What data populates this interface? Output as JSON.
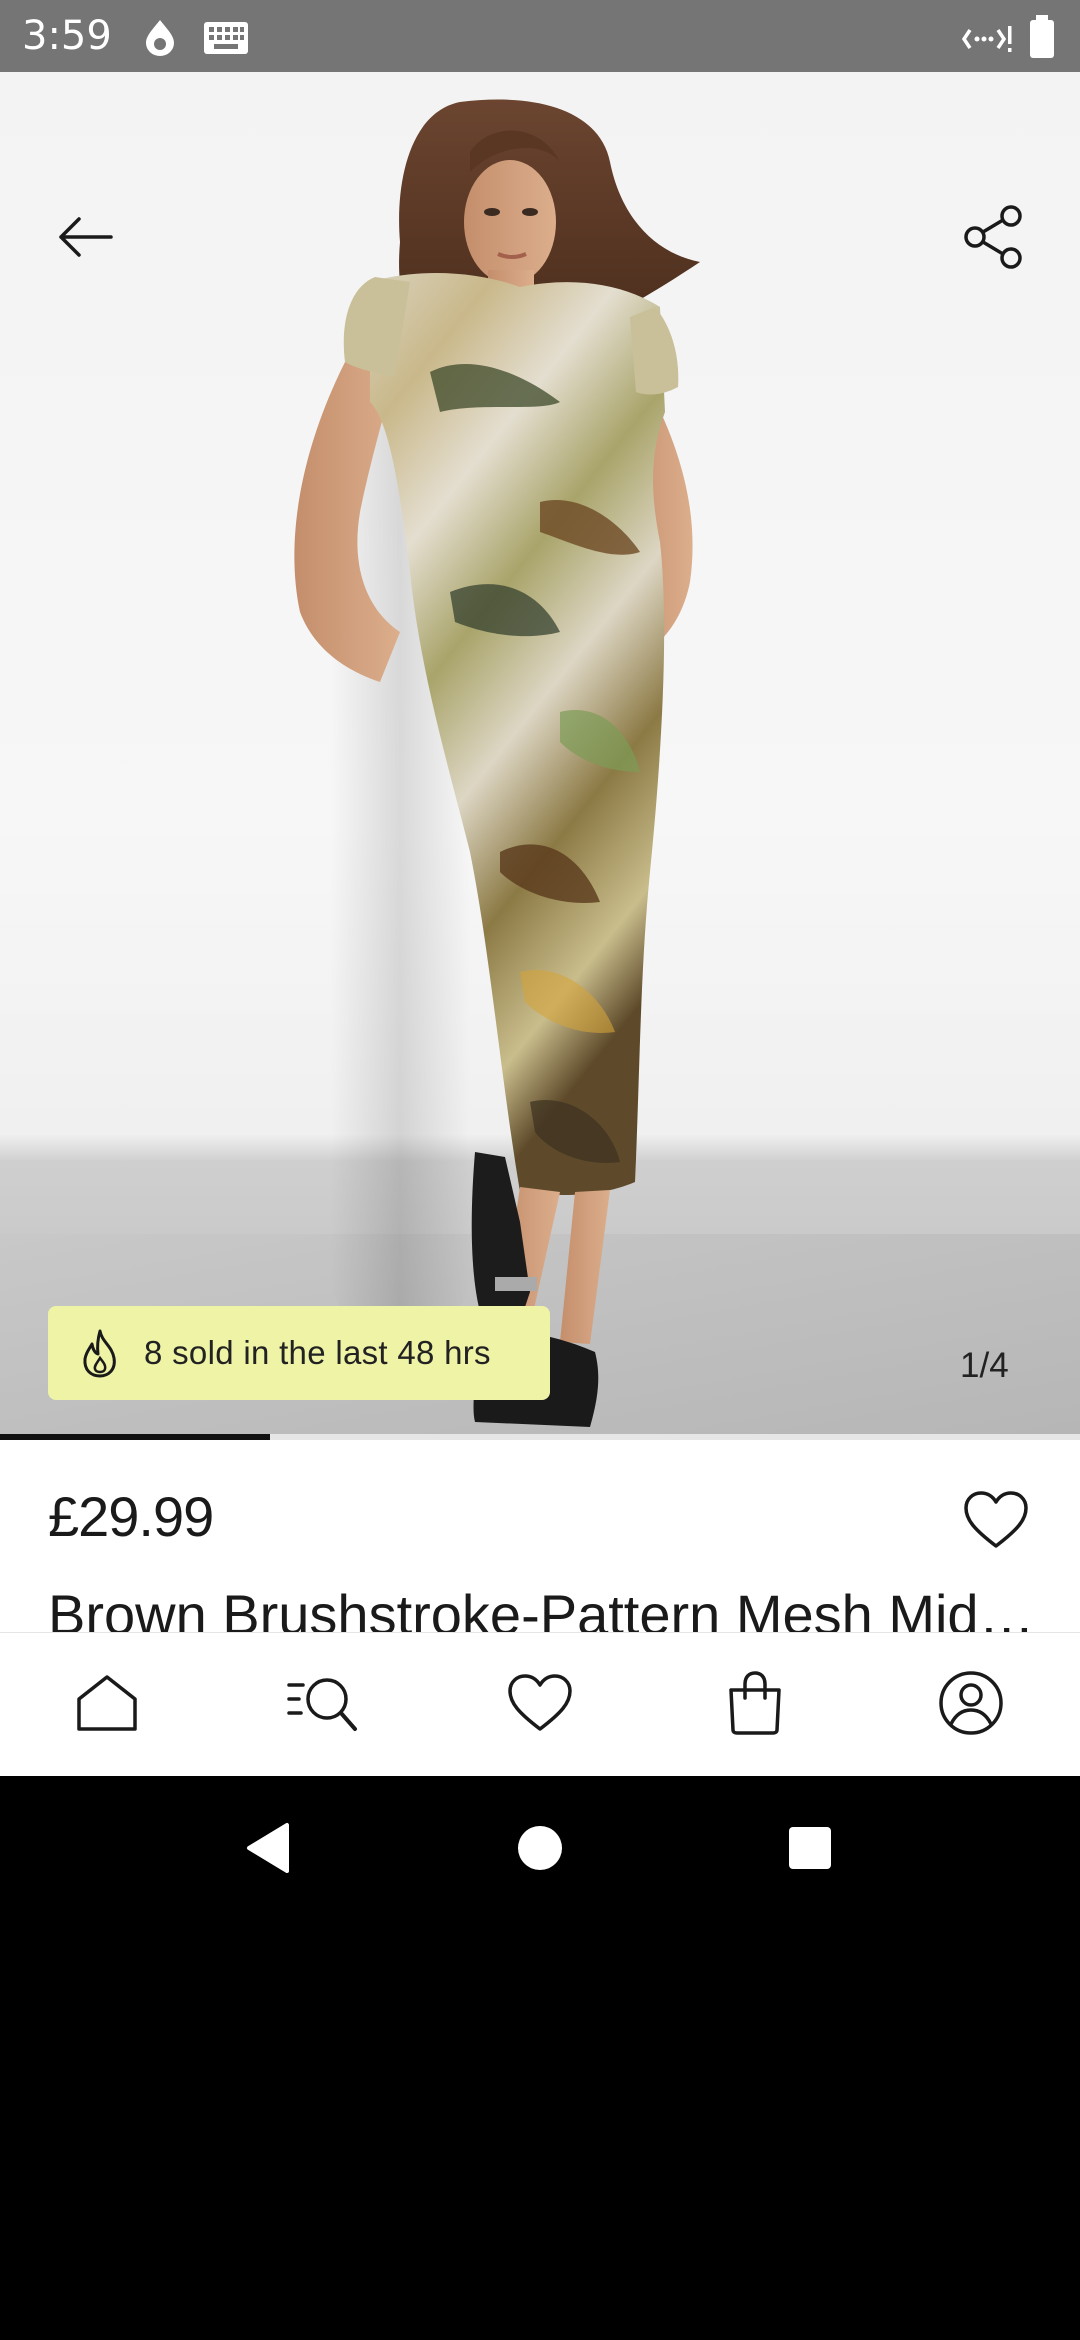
{
  "status_bar": {
    "time": "3:59",
    "icons": [
      "drop-icon",
      "keyboard-icon",
      "data-saver-icon",
      "battery-icon"
    ]
  },
  "gallery": {
    "back_icon": "arrow-left-icon",
    "share_icon": "share-icon",
    "badge_icon": "flame-icon",
    "badge_text": "8 sold in the last 48 hrs",
    "pager_text": "1/4",
    "current_image": 1,
    "total_images": 4,
    "badge_color": "#eef3a6"
  },
  "product": {
    "price": "£29.99",
    "title": "Brown Brushstroke-Pattern Mesh Midi Dress",
    "wishlist_icon": "heart-outline-icon"
  },
  "bottom_nav": {
    "items": [
      {
        "icon": "home-icon"
      },
      {
        "icon": "search-list-icon"
      },
      {
        "icon": "heart-icon"
      },
      {
        "icon": "shopping-bag-icon"
      },
      {
        "icon": "account-icon"
      }
    ]
  },
  "system_nav": {
    "items": [
      {
        "icon": "back-triangle-icon"
      },
      {
        "icon": "home-circle-icon"
      },
      {
        "icon": "recents-square-icon"
      }
    ]
  }
}
